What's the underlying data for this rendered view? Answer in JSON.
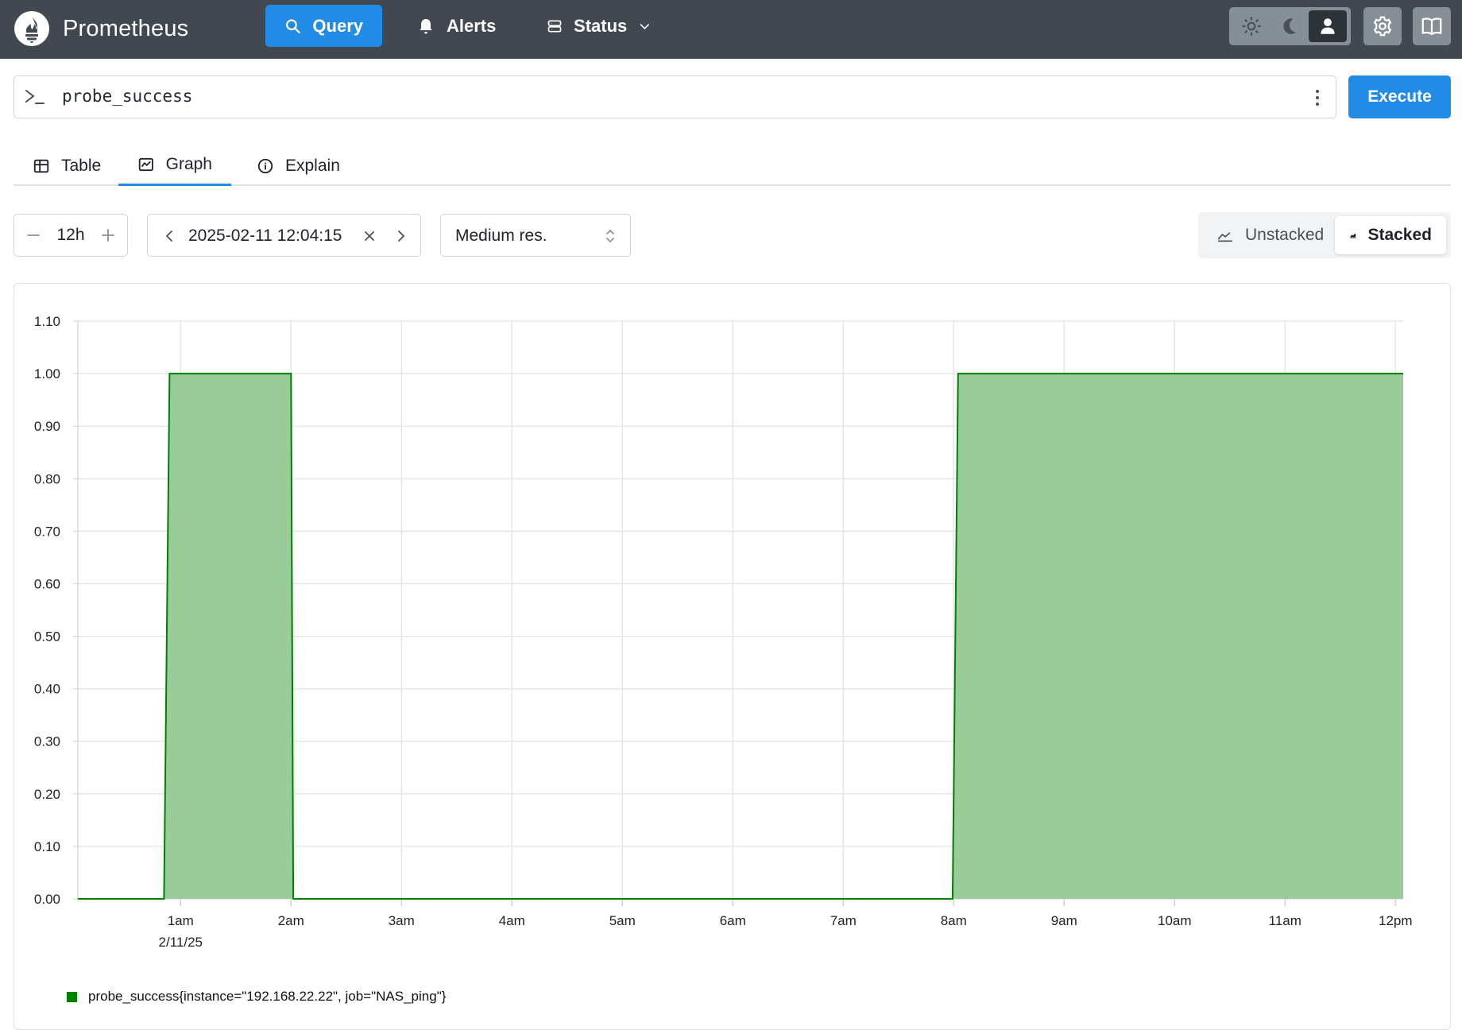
{
  "app": {
    "name": "Prometheus",
    "logo_icon": "prometheus-flame-logo"
  },
  "nav": {
    "query_label": "Query",
    "alerts_label": "Alerts",
    "status_label": "Status",
    "theme_options": [
      "light",
      "dark",
      "auto"
    ],
    "active_theme": "auto"
  },
  "expression": {
    "value": "probe_success",
    "execute_label": "Execute"
  },
  "tabs": [
    {
      "label": "Table",
      "icon": "table-icon",
      "active": false
    },
    {
      "label": "Graph",
      "icon": "graph-icon",
      "active": true
    },
    {
      "label": "Explain",
      "icon": "info-icon",
      "active": false
    }
  ],
  "controls": {
    "range": "12h",
    "end_time": "2025-02-11 12:04:15",
    "resolution": "Medium res.",
    "stack_unstacked_label": "Unstacked",
    "stack_stacked_label": "Stacked",
    "stack_mode": "stacked"
  },
  "colors": {
    "brand_blue": "#228be6",
    "navbar": "#41484f",
    "series_line": "#008000",
    "series_fill": "#99cc99"
  },
  "chart_data": {
    "type": "area",
    "title": "",
    "xlabel": "",
    "ylabel": "",
    "ylim": [
      0,
      1.1
    ],
    "y_ticks": [
      "0.00",
      "0.10",
      "0.20",
      "0.30",
      "0.40",
      "0.50",
      "0.60",
      "0.70",
      "0.80",
      "0.90",
      "1.00",
      "1.10"
    ],
    "x_range_hours": [
      0.07,
      12.07
    ],
    "x_ticks": [
      {
        "hour": 1,
        "label": "1am",
        "sublabel": "2/11/25"
      },
      {
        "hour": 2,
        "label": "2am"
      },
      {
        "hour": 3,
        "label": "3am"
      },
      {
        "hour": 4,
        "label": "4am"
      },
      {
        "hour": 5,
        "label": "5am"
      },
      {
        "hour": 6,
        "label": "6am"
      },
      {
        "hour": 7,
        "label": "7am"
      },
      {
        "hour": 8,
        "label": "8am"
      },
      {
        "hour": 9,
        "label": "9am"
      },
      {
        "hour": 10,
        "label": "10am"
      },
      {
        "hour": 11,
        "label": "11am"
      },
      {
        "hour": 12,
        "label": "12pm"
      }
    ],
    "grid": true,
    "legend_position": "bottom-left",
    "series": [
      {
        "name": "probe_success{instance=\"192.168.22.22\", job=\"NAS_ping\"}",
        "color": "#008000",
        "points": [
          [
            0.07,
            0
          ],
          [
            0.85,
            0
          ],
          [
            0.9,
            1
          ],
          [
            2.0,
            1
          ],
          [
            2.02,
            0
          ],
          [
            7.99,
            0
          ],
          [
            8.04,
            1
          ],
          [
            12.07,
            1
          ]
        ]
      }
    ]
  }
}
